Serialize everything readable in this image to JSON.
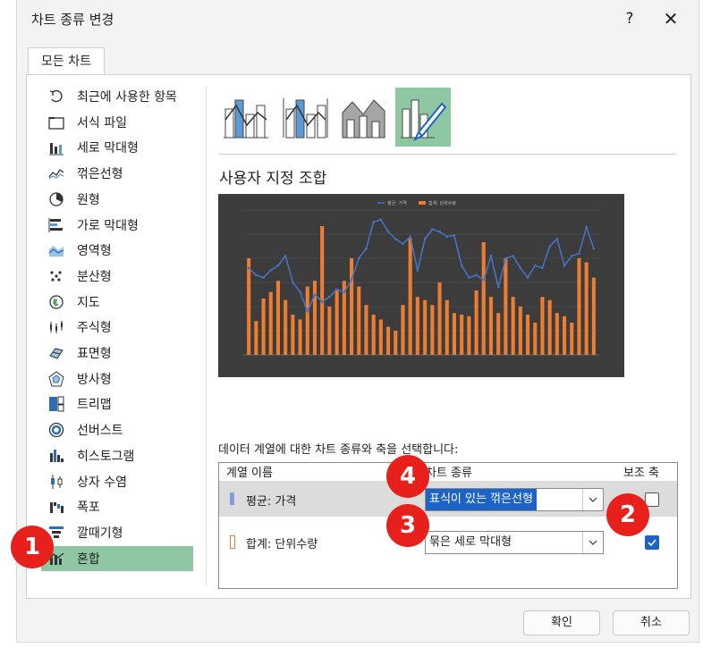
{
  "window": {
    "title": "차트 종류 변경",
    "help": "?",
    "close": "✕"
  },
  "tab": {
    "label": "모든 차트"
  },
  "categories": [
    {
      "label": "최근에 사용한 항목",
      "icon": "recent-icon"
    },
    {
      "label": "서식 파일",
      "icon": "folder-icon"
    },
    {
      "label": "세로 막대형",
      "icon": "column-chart-icon"
    },
    {
      "label": "꺾은선형",
      "icon": "line-chart-icon"
    },
    {
      "label": "원형",
      "icon": "pie-chart-icon"
    },
    {
      "label": "가로 막대형",
      "icon": "bar-chart-icon"
    },
    {
      "label": "영역형",
      "icon": "area-chart-icon"
    },
    {
      "label": "분산형",
      "icon": "scatter-chart-icon"
    },
    {
      "label": "지도",
      "icon": "map-chart-icon"
    },
    {
      "label": "주식형",
      "icon": "stock-chart-icon"
    },
    {
      "label": "표면형",
      "icon": "surface-chart-icon"
    },
    {
      "label": "방사형",
      "icon": "radar-chart-icon"
    },
    {
      "label": "트리맵",
      "icon": "treemap-chart-icon"
    },
    {
      "label": "선버스트",
      "icon": "sunburst-chart-icon"
    },
    {
      "label": "히스토그램",
      "icon": "histogram-chart-icon"
    },
    {
      "label": "상자 수염",
      "icon": "box-whisker-chart-icon"
    },
    {
      "label": "폭포",
      "icon": "waterfall-chart-icon"
    },
    {
      "label": "깔때기형",
      "icon": "funnel-chart-icon"
    },
    {
      "label": "혼합",
      "icon": "combo-chart-icon",
      "selected": true
    }
  ],
  "combo": {
    "title": "사용자 지정 조합",
    "thumbnails": [
      "clustered-column-line-icon",
      "clustered-column-line-secondary-icon",
      "stacked-area-column-icon",
      "custom-combo-icon"
    ]
  },
  "preview": {
    "legend": [
      "평균: 가격",
      "합계: 단위수량"
    ],
    "line_color": "#4472c4",
    "bar_color": "#ed7d31",
    "bg_color": "#3c3c3c"
  },
  "series_section": {
    "prompt": "데이터 계열에 대한 차트 종류와 축을 선택합니다:",
    "headers": {
      "name": "계열 이름",
      "type": "차트 종류",
      "axis": "보조 축"
    },
    "rows": [
      {
        "name": "평균: 가격",
        "type": "표식이 있는 꺾은선형",
        "secondary": false,
        "color": "#7f9fd8"
      },
      {
        "name": "합계: 단위수량",
        "type": "묶은 세로 막대형",
        "secondary": true,
        "color": "#ed7d31"
      }
    ]
  },
  "buttons": {
    "ok": "확인",
    "cancel": "취소"
  },
  "annotations": [
    "1",
    "2",
    "3",
    "4"
  ],
  "colors": {
    "selection": "#8fc7a3",
    "badge": "#e8201b",
    "highlight": "#1e64c8"
  }
}
